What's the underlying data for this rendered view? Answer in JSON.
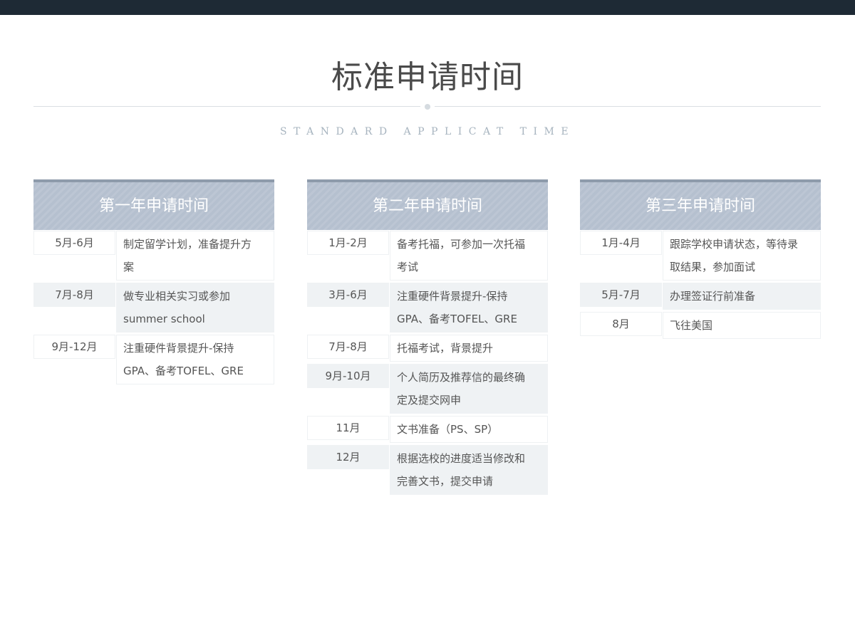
{
  "page": {
    "title": "标准申请时间",
    "subtitle": "STANDARD APPLICAT TIME"
  },
  "colors": {
    "topbar": "#1e2a35",
    "header_bg": "#b5c0cf",
    "header_border": "#8e9bab",
    "row_shade": "#eff2f4"
  },
  "columns": [
    {
      "header": "第一年申请时间",
      "rows": [
        {
          "month": "5月-6月",
          "desc": "制定留学计划，准备提升方\n案",
          "shade": false
        },
        {
          "month": "7月-8月",
          "desc": "做专业相关实习或参加\nsummer school",
          "shade": true
        },
        {
          "month": "9月-12月",
          "desc": "注重硬件背景提升-保持\nGPA、备考TOFEL、GRE",
          "shade": false
        }
      ]
    },
    {
      "header": "第二年申请时间",
      "rows": [
        {
          "month": "1月-2月",
          "desc": "备考托福，可参加一次托福\n考试",
          "shade": false
        },
        {
          "month": "3月-6月",
          "desc": "注重硬件背景提升-保持\nGPA、备考TOFEL、GRE",
          "shade": true
        },
        {
          "month": "7月-8月",
          "desc": "托福考试，背景提升",
          "shade": false
        },
        {
          "month": "9月-10月",
          "desc": "个人简历及推荐信的最终确\n定及提交网申",
          "shade": true
        },
        {
          "month": "11月",
          "desc": "文书准备（PS、SP）",
          "shade": false
        },
        {
          "month": "12月",
          "desc": "根据选校的进度适当修改和\n完善文书，提交申请",
          "shade": true
        }
      ]
    },
    {
      "header": "第三年申请时间",
      "rows": [
        {
          "month": "1月-4月",
          "desc": "跟踪学校申请状态，等待录\n取结果，参加面试",
          "shade": false
        },
        {
          "month": "5月-7月",
          "desc": "办理签证行前准备",
          "shade": true
        },
        {
          "month": "8月",
          "desc": "飞往美国",
          "shade": false
        }
      ]
    }
  ]
}
